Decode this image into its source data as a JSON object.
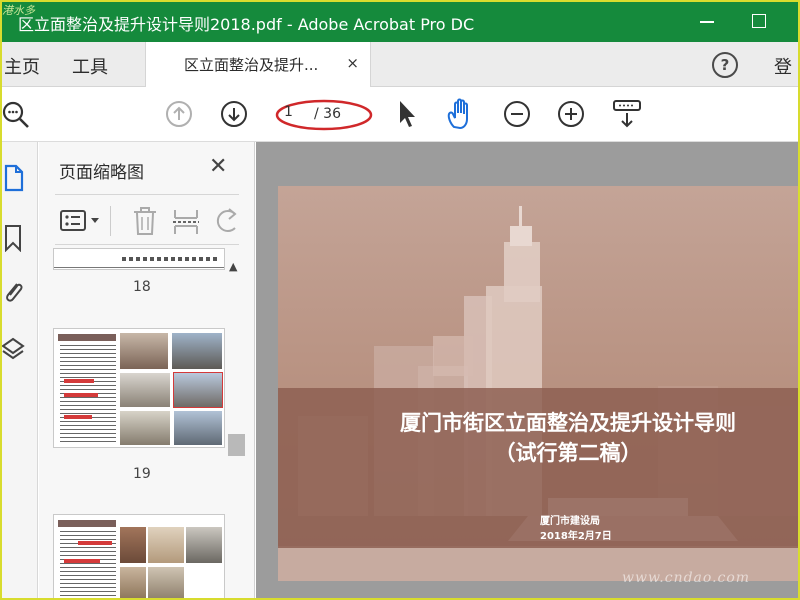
{
  "window": {
    "title": "区立面整治及提升设计导则2018.pdf - Adobe Acrobat Pro DC",
    "watermark": "港水多"
  },
  "menu": {
    "home": "主页",
    "tools": "工具",
    "login": "登"
  },
  "tab": {
    "label": "区立面整治及提升...",
    "close": "×"
  },
  "help": "?",
  "toolbar": {
    "page_current": "1",
    "page_total": "/ 36"
  },
  "panel": {
    "title": "页面缩略图",
    "close": "✕",
    "thumbnails": [
      {
        "page": "18"
      },
      {
        "page": "19"
      }
    ]
  },
  "document": {
    "title_line1": "厦门市街区立面整治及提升设计导则",
    "title_line2": "（试行第二稿）",
    "org": "厦门市建设局",
    "date": "2018年2月7日"
  },
  "site_watermark": "www.cndao.com",
  "colors": {
    "titlebar": "#158a3c",
    "accent_blue": "#1e6fd9",
    "highlight_circle": "#d0282a"
  }
}
